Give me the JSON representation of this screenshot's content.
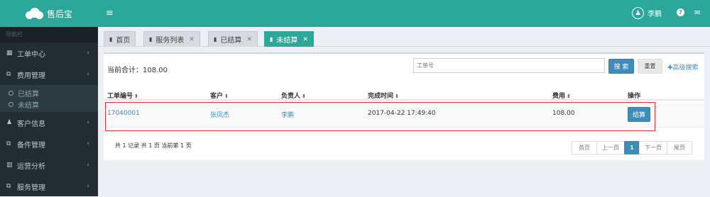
{
  "app": {
    "logo_text": "售后宝"
  },
  "sidebar": {
    "nav_header": "导航栏",
    "items": [
      {
        "icon": "calendar-icon",
        "glyph": "▦",
        "label": "工单中心"
      },
      {
        "icon": "edit-icon",
        "glyph": "⧉",
        "label": "费用管理"
      },
      {
        "icon": "user-icon",
        "glyph": "♟",
        "label": "客户信息"
      },
      {
        "icon": "edit-icon",
        "glyph": "⧉",
        "label": "备件管理"
      },
      {
        "icon": "bar-chart-icon",
        "glyph": "▥",
        "label": "运营分析"
      },
      {
        "icon": "edit-icon",
        "glyph": "⧉",
        "label": "服务管理"
      }
    ],
    "submenu": [
      {
        "label": "已结算",
        "active": false
      },
      {
        "label": "未结算",
        "active": true
      }
    ]
  },
  "header": {
    "menu_glyph": "≡",
    "user_name": "李鹏",
    "help_glyph": "?",
    "chat_glyph": "✉"
  },
  "tabs": [
    {
      "label": "首页",
      "closable": false
    },
    {
      "label": "服务列表",
      "closable": true
    },
    {
      "label": "已结算",
      "closable": true
    },
    {
      "label": "未结算",
      "closable": true,
      "active": true
    }
  ],
  "main": {
    "total_text": "当前合计：108.00",
    "search_placeholder": "工单号",
    "search_button": "搜 索",
    "reset_button": "重置",
    "advanced_search": "✚高级搜索",
    "table": {
      "columns": [
        "工单编号",
        "客户",
        "负责人",
        "完成时间",
        "费用",
        "操作"
      ],
      "sort_glyph": "⇕",
      "rows": [
        {
          "order_no": "17040001",
          "customer": "张凤杰",
          "owner": "李鹏",
          "finish_time": "2017-04-22 17:49:40",
          "fee": "108.00",
          "action": "结算"
        }
      ]
    },
    "page_info": "共 1 记录  共 1 页  当前第 1 页",
    "pagination": [
      "首页",
      "上一页",
      "1",
      "下一页",
      "尾页"
    ],
    "current_page": "1"
  },
  "colors": {
    "accent": "#2ba899",
    "primary_button": "#3c8dbc",
    "sidebar_bg": "#222d32",
    "highlight_box": "#e03535"
  }
}
